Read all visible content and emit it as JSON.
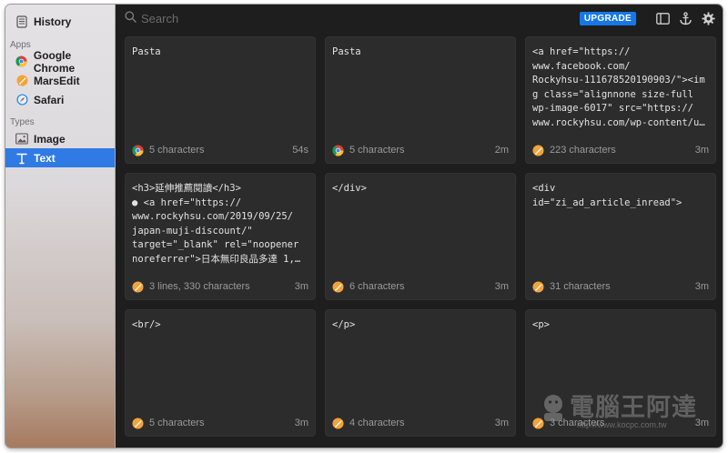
{
  "sidebar": {
    "history_label": "History",
    "apps_section": "Apps",
    "apps": [
      {
        "label": "Google Chrome",
        "icon": "chrome-icon"
      },
      {
        "label": "MarsEdit",
        "icon": "marsedit-icon"
      },
      {
        "label": "Safari",
        "icon": "safari-icon"
      }
    ],
    "types_section": "Types",
    "types": [
      {
        "label": "Image",
        "icon": "image-icon"
      },
      {
        "label": "Text",
        "icon": "text-icon",
        "selected": true
      }
    ]
  },
  "toolbar": {
    "search_placeholder": "Search",
    "upgrade_label": "UPGRADE"
  },
  "cards": [
    {
      "content": "Pasta",
      "app": "chrome",
      "count": "5 characters",
      "time": "54s"
    },
    {
      "content": "Pasta",
      "app": "chrome",
      "count": "5 characters",
      "time": "2m"
    },
    {
      "content": "<a href=\"https://\nwww.facebook.com/\nRockyhsu-111678520190903/\"><im\ng class=\"alignnone size-full\nwp-image-6017\" src=\"https://\nwww.rockyhsu.com/wp-content/u…",
      "app": "marsedit",
      "count": "223 characters",
      "time": "3m"
    },
    {
      "content": "<h3>延伸推薦閱讀</h3>\n● <a href=\"https://\nwww.rockyhsu.com/2019/09/25/\njapan-muji-discount/\"\ntarget=\"_blank\" rel=\"noopener\nnoreferrer\">日本無印良品多達 1,…",
      "app": "marsedit",
      "count": "3 lines, 330 characters",
      "time": "3m"
    },
    {
      "content": "</div>",
      "app": "marsedit",
      "count": "6 characters",
      "time": "3m"
    },
    {
      "content": "<div\nid=\"zi_ad_article_inread\">",
      "app": "marsedit",
      "count": "31 characters",
      "time": "3m"
    },
    {
      "content": "<br/>",
      "app": "marsedit",
      "count": "5 characters",
      "time": "3m"
    },
    {
      "content": "</p>",
      "app": "marsedit",
      "count": "4 characters",
      "time": "3m"
    },
    {
      "content": "<p>",
      "app": "marsedit",
      "count": "3 characters",
      "time": "3m"
    }
  ],
  "watermark": {
    "text": "電腦王阿達",
    "url": "http://www.kocpc.com.tw"
  },
  "colors": {
    "accent": "#2f7ae5",
    "upgrade": "#1777e8",
    "card_bg": "#2c2c2c",
    "main_bg": "#1e1e1e"
  }
}
